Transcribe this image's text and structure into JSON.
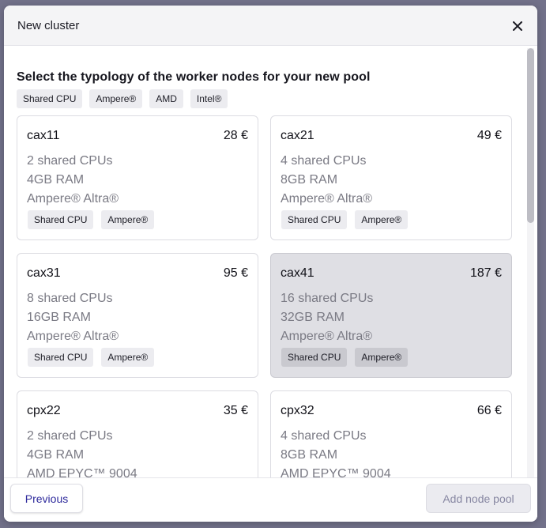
{
  "modal": {
    "title": "New cluster",
    "heading": "Select the typology of the worker nodes for your new pool"
  },
  "filters": [
    "Shared CPU",
    "Ampere®",
    "AMD",
    "Intel®"
  ],
  "cards": [
    {
      "name": "cax11",
      "price": "28 €",
      "cpu": "2 shared CPUs",
      "ram": "4GB RAM",
      "processor": "Ampere® Altra®",
      "tags": [
        "Shared CPU",
        "Ampere®"
      ],
      "selected": false
    },
    {
      "name": "cax21",
      "price": "49 €",
      "cpu": "4 shared CPUs",
      "ram": "8GB RAM",
      "processor": "Ampere® Altra®",
      "tags": [
        "Shared CPU",
        "Ampere®"
      ],
      "selected": false
    },
    {
      "name": "cax31",
      "price": "95 €",
      "cpu": "8 shared CPUs",
      "ram": "16GB RAM",
      "processor": "Ampere® Altra®",
      "tags": [
        "Shared CPU",
        "Ampere®"
      ],
      "selected": false
    },
    {
      "name": "cax41",
      "price": "187 €",
      "cpu": "16 shared CPUs",
      "ram": "32GB RAM",
      "processor": "Ampere® Altra®",
      "tags": [
        "Shared CPU",
        "Ampere®"
      ],
      "selected": true
    },
    {
      "name": "cpx22",
      "price": "35 €",
      "cpu": "2 shared CPUs",
      "ram": "4GB RAM",
      "processor": "AMD EPYC™ 9004",
      "tags": [],
      "selected": false
    },
    {
      "name": "cpx32",
      "price": "66 €",
      "cpu": "4 shared CPUs",
      "ram": "8GB RAM",
      "processor": "AMD EPYC™ 9004",
      "tags": [],
      "selected": false
    }
  ],
  "footer": {
    "previous_label": "Previous",
    "add_label": "Add node pool"
  },
  "colors": {
    "backdrop": "#72718a",
    "primary_text": "#2e2a9c",
    "selected_card": "#dfdfe4"
  },
  "icons": {
    "close": "close-icon"
  }
}
